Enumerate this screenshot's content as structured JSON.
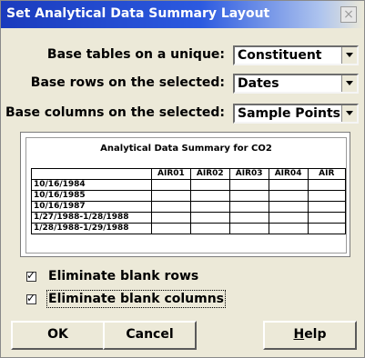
{
  "window": {
    "title": "Set Analytical Data Summary Layout",
    "close_label": "×"
  },
  "options": [
    {
      "label": "Base tables on a unique:",
      "value": "Constituent"
    },
    {
      "label": "Base rows on the selected:",
      "value": "Dates"
    },
    {
      "label": "Base columns on the selected:",
      "value": "Sample Points"
    }
  ],
  "preview": {
    "title": "Analytical Data Summary for CO2",
    "columns": [
      "",
      "AIR01",
      "AIR02",
      "AIR03",
      "AIR04",
      "AIR"
    ],
    "rows": [
      "10/16/1984",
      "10/16/1985",
      "10/16/1987",
      "1/27/1988-1/28/1988",
      "1/28/1988-1/29/1988"
    ]
  },
  "checkboxes": [
    {
      "label": "Eliminate blank rows",
      "checked": true,
      "mark": "✓"
    },
    {
      "label": "Eliminate blank columns",
      "checked": true,
      "mark": "✓"
    }
  ],
  "buttons": {
    "ok": "OK",
    "cancel": "Cancel",
    "help": "Help"
  }
}
